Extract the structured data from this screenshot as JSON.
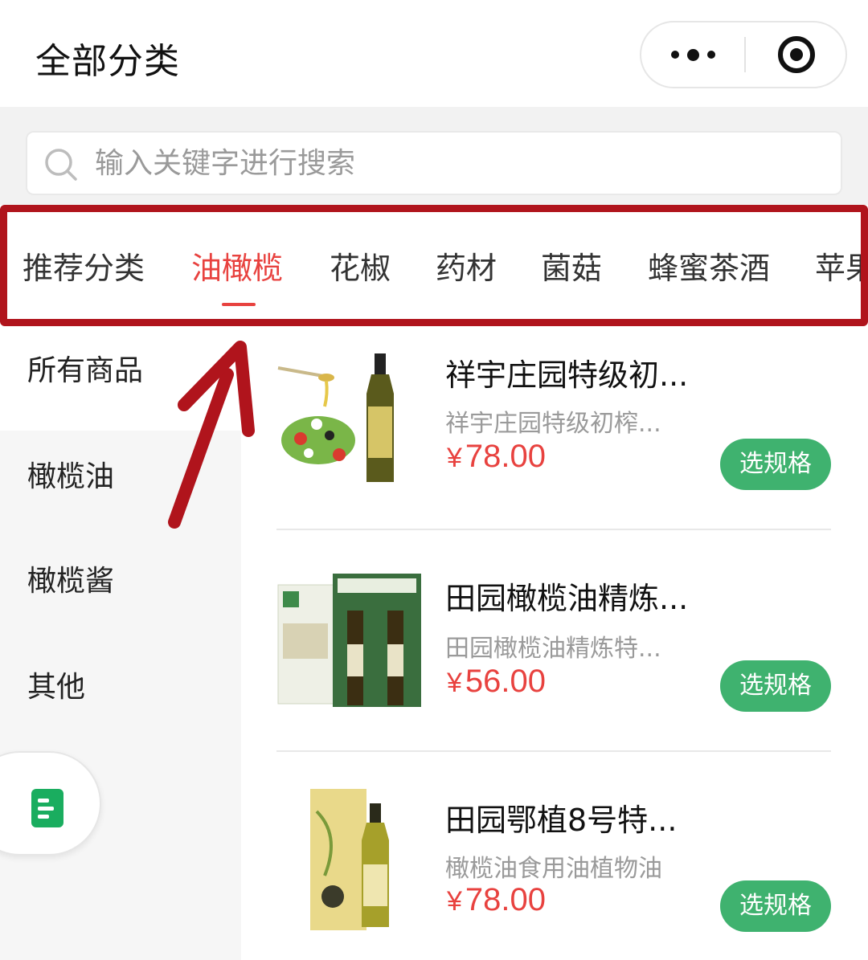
{
  "header": {
    "title": "全部分类"
  },
  "search": {
    "placeholder": "输入关键字进行搜索"
  },
  "tabs": [
    {
      "label": "推荐分类",
      "active": false
    },
    {
      "label": "油橄榄",
      "active": true
    },
    {
      "label": "花椒",
      "active": false
    },
    {
      "label": "药材",
      "active": false
    },
    {
      "label": "菌菇",
      "active": false
    },
    {
      "label": "蜂蜜茶酒",
      "active": false
    },
    {
      "label": "苹果",
      "active": false
    }
  ],
  "sidebar": {
    "items": [
      {
        "label": "所有商品",
        "active": true
      },
      {
        "label": "橄榄油",
        "active": false
      },
      {
        "label": "橄榄酱",
        "active": false
      },
      {
        "label": "其他",
        "active": false
      }
    ]
  },
  "products": [
    {
      "name": "祥宇庄园特级初...",
      "desc": "祥宇庄园特级初榨...",
      "currency": "¥",
      "price": "78.00",
      "button": "选规格"
    },
    {
      "name": "田园橄榄油精炼...",
      "desc": "田园橄榄油精炼特...",
      "currency": "¥",
      "price": "56.00",
      "button": "选规格"
    },
    {
      "name": "田园鄂植8号特...",
      "desc": "橄榄油食用油植物油",
      "currency": "¥",
      "price": "78.00",
      "button": "选规格"
    }
  ],
  "colors": {
    "accent": "#e8423f",
    "button_green": "#3fb26f",
    "annotation_red": "#b0141c",
    "doc_icon_green": "#1aad5f"
  },
  "icons": {
    "more": "more-dots-icon",
    "close": "target-circle-icon",
    "search": "search-icon",
    "float": "document-icon"
  }
}
